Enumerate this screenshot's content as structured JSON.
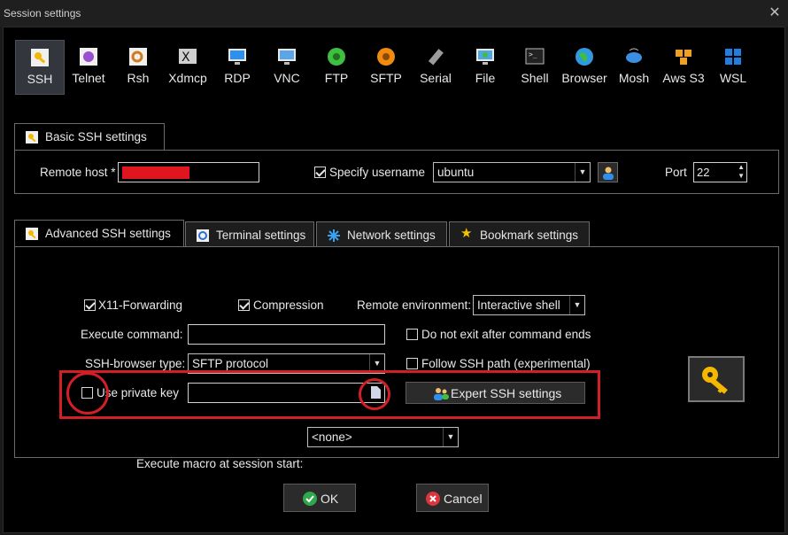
{
  "window": {
    "title": "Session settings"
  },
  "protocols": [
    {
      "label": "SSH",
      "icon": "ssh-key-icon",
      "color": "#f5b800",
      "selected": true
    },
    {
      "label": "Telnet",
      "icon": "telnet-icon",
      "color": "#9a4fcf"
    },
    {
      "label": "Rsh",
      "icon": "rsh-icon",
      "color": "#d27b1c"
    },
    {
      "label": "Xdmcp",
      "icon": "xdmcp-icon",
      "color": "#d0d0d0"
    },
    {
      "label": "RDP",
      "icon": "rdp-icon",
      "color": "#2d8ff0"
    },
    {
      "label": "VNC",
      "icon": "vnc-icon",
      "color": "#5aa6e8"
    },
    {
      "label": "FTP",
      "icon": "ftp-icon",
      "color": "#3fbf3f"
    },
    {
      "label": "SFTP",
      "icon": "sftp-icon",
      "color": "#f08a10"
    },
    {
      "label": "Serial",
      "icon": "serial-icon",
      "color": "#9b9b9b"
    },
    {
      "label": "File",
      "icon": "file-icon",
      "color": "#4fa6e0"
    },
    {
      "label": "Shell",
      "icon": "shell-icon",
      "color": "#3a3a3a"
    },
    {
      "label": "Browser",
      "icon": "browser-icon",
      "color": "#2f9ae0"
    },
    {
      "label": "Mosh",
      "icon": "mosh-icon",
      "color": "#3c8fe0"
    },
    {
      "label": "Aws S3",
      "icon": "aws-s3-icon",
      "color": "#f0a020"
    },
    {
      "label": "WSL",
      "icon": "wsl-icon",
      "color": "#1f7fe0"
    }
  ],
  "basic": {
    "tab_label": "Basic SSH settings",
    "remote_host_label": "Remote host *",
    "remote_host_value": "",
    "remote_host_redacted": true,
    "specify_username_label": "Specify username",
    "specify_username_checked": true,
    "username_value": "ubuntu",
    "port_label": "Port",
    "port_value": "22"
  },
  "advanced_tabs": [
    {
      "label": "Advanced SSH settings",
      "icon": "key-icon",
      "active": true
    },
    {
      "label": "Terminal settings",
      "icon": "terminal-icon"
    },
    {
      "label": "Network settings",
      "icon": "network-icon"
    },
    {
      "label": "Bookmark settings",
      "icon": "star-icon"
    }
  ],
  "advanced": {
    "x11_label": "X11-Forwarding",
    "x11_checked": true,
    "compression_label": "Compression",
    "compression_checked": true,
    "remote_env_label": "Remote environment:",
    "remote_env_value": "Interactive shell",
    "execute_command_label": "Execute command:",
    "execute_command_value": "",
    "no_exit_label": "Do not exit after command ends",
    "no_exit_checked": false,
    "browser_type_label": "SSH-browser type:",
    "browser_type_value": "SFTP protocol",
    "follow_path_label": "Follow SSH path (experimental)",
    "follow_path_checked": false,
    "use_private_key_label": "Use private key",
    "use_private_key_checked": false,
    "private_key_path": "",
    "expert_button_label": "Expert SSH settings",
    "macro_label": "Execute macro at session start:",
    "macro_value": "<none>"
  },
  "footer": {
    "ok_label": "OK",
    "cancel_label": "Cancel"
  },
  "colors": {
    "annotation": "#d21f26",
    "redacted": "#e0161e",
    "ok_green": "#2ea84a",
    "cancel_red": "#d9363e"
  }
}
